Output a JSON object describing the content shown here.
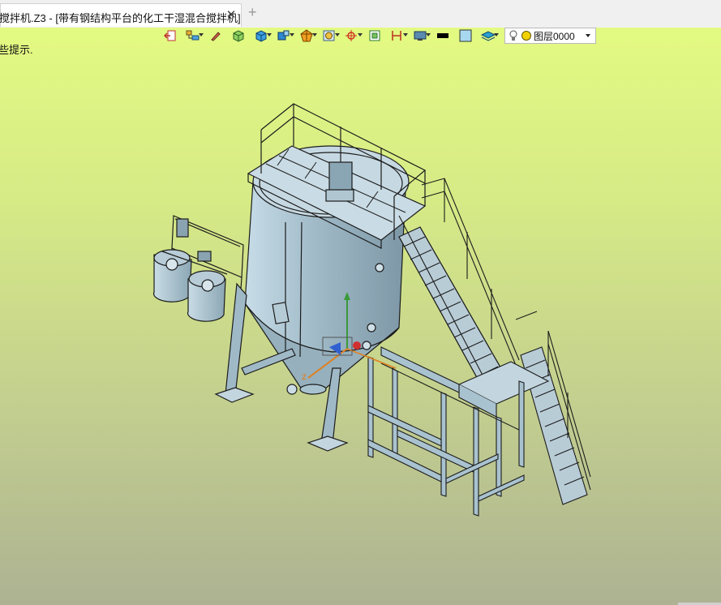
{
  "tab": {
    "title": "搅拌机.Z3 - [带有钢结构平台的化工干湿混合搅拌机]",
    "close_icon": "close-icon",
    "add_icon": "plus-icon"
  },
  "viewport": {
    "hint_text": "些提示.",
    "background_top": "#e3fa82",
    "background_bottom": "#adb292"
  },
  "toolbar": {
    "buttons": [
      {
        "name": "exit-icon"
      },
      {
        "name": "layer-tree-icon"
      },
      {
        "name": "pencil-icon"
      },
      {
        "name": "solid-box-icon"
      },
      {
        "name": "shaded-cube-icon"
      },
      {
        "name": "view-cube-icon"
      },
      {
        "name": "render-style-icon"
      },
      {
        "name": "display-mode-icon"
      },
      {
        "name": "origin-icon"
      },
      {
        "name": "zoom-fit-icon"
      },
      {
        "name": "dimension-icon"
      },
      {
        "name": "screen-icon"
      },
      {
        "name": "black-color-icon"
      },
      {
        "name": "blue-color-icon"
      },
      {
        "name": "layers-icon"
      }
    ],
    "layer_select_value": "图层0000",
    "lightbulb_icon": "lightbulb-icon",
    "layer_dot_color": "#f1d100"
  },
  "model": {
    "steel_color": "#a9c2cf",
    "outline_color": "#1c1c1c"
  }
}
